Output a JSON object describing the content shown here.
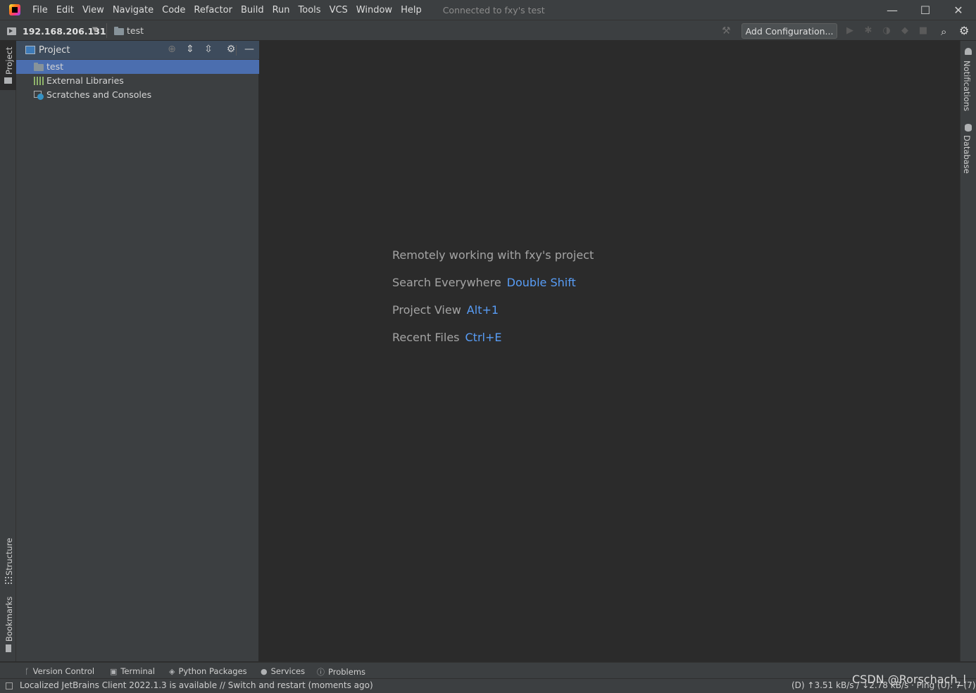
{
  "menu": [
    "File",
    "Edit",
    "View",
    "Navigate",
    "Code",
    "Refactor",
    "Build",
    "Run",
    "Tools",
    "VCS",
    "Window",
    "Help"
  ],
  "title": {
    "connected": "Connected to fxy's test"
  },
  "window_controls": {
    "minimize": "—",
    "maximize": "☐",
    "close": "✕"
  },
  "toolbar": {
    "host": "192.168.206.131",
    "breadcrumb": "test",
    "add_configuration": "Add Configuration..."
  },
  "left_stripe": {
    "project": "Project",
    "structure": "Structure",
    "bookmarks": "Bookmarks"
  },
  "right_stripe": {
    "notifications": "Notifications",
    "database": "Database"
  },
  "project_panel": {
    "title": "Project",
    "tree": [
      {
        "label": "test",
        "icon": "folder-icon",
        "selected": true
      },
      {
        "label": "External Libraries",
        "icon": "libraries-icon",
        "selected": false
      },
      {
        "label": "Scratches and Consoles",
        "icon": "scratches-icon",
        "selected": false
      }
    ]
  },
  "editor": {
    "headline": "Remotely working with fxy's project",
    "hints": [
      {
        "label": "Search Everywhere",
        "shortcut": "Double Shift"
      },
      {
        "label": "Project View",
        "shortcut": "Alt+1"
      },
      {
        "label": "Recent Files",
        "shortcut": "Ctrl+E"
      }
    ]
  },
  "bottom_tools": [
    "Version Control",
    "Terminal",
    "Python Packages",
    "Services",
    "Problems"
  ],
  "status": {
    "message": "Localized JetBrains Client 2022.1.3 is available // Switch and restart (moments ago)",
    "network": "(D) ↑3.51 kB/s / ↓2.78 kB/s · Ping (U): 7 (7)"
  },
  "watermark": "CSDN @Rorschach_l",
  "colors": {
    "accent": "#589df6",
    "selection": "#4b6eaf",
    "panel_header": "#3d4b5c",
    "background": "#2b2b2b",
    "chrome": "#3c3f41"
  }
}
